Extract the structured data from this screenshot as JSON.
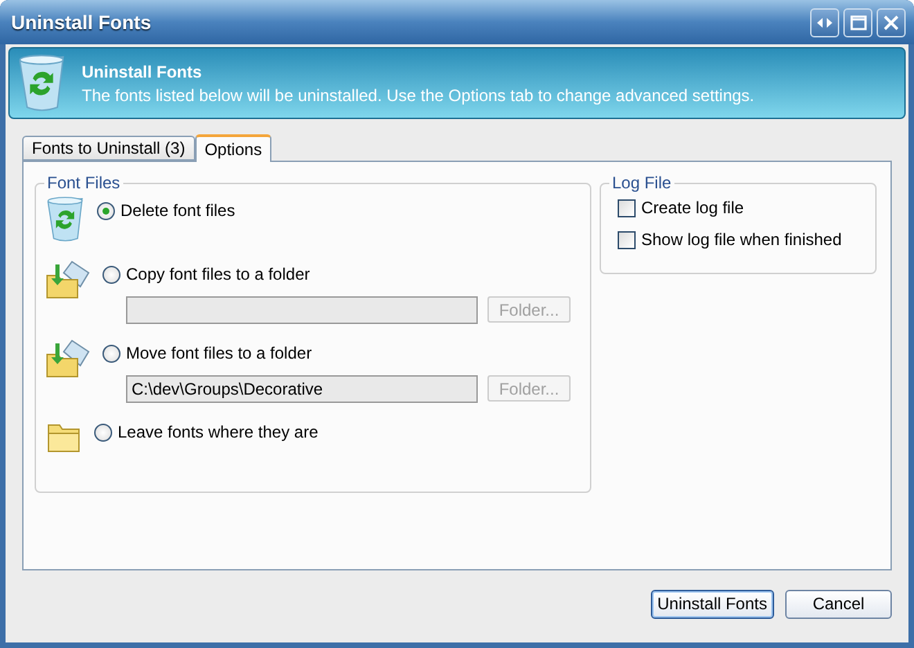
{
  "window": {
    "title": "Uninstall Fonts"
  },
  "header": {
    "title": "Uninstall Fonts",
    "text": "The fonts listed below will be uninstalled. Use the Options tab to change advanced settings."
  },
  "tabs": [
    {
      "label": "Fonts to Uninstall (3)",
      "selected": false
    },
    {
      "label": "Options",
      "selected": true
    }
  ],
  "font_files": {
    "title": "Font Files",
    "options": [
      {
        "label": "Delete font files",
        "selected": true,
        "kind": "bin"
      },
      {
        "label": "Copy font files to a folder",
        "selected": false,
        "kind": "folders",
        "field": {
          "button": {
            "label": "Folder...",
            "disabled": true
          }
        }
      },
      {
        "label": "Move font files to a folder",
        "selected": false,
        "kind": "folders",
        "field": {
          "value": "C:\\dev\\Groups\\Decorative",
          "button": {
            "label": "Folder...",
            "disabled": true
          }
        }
      },
      {
        "label": "Leave fonts where they are",
        "selected": false,
        "kind": "folder"
      }
    ]
  },
  "log_file": {
    "title": "Log File",
    "options": [
      {
        "label": "Create log file",
        "checked": false
      },
      {
        "label": "Show log file when finished",
        "checked": false
      }
    ]
  },
  "buttons": [
    {
      "label": "Uninstall Fonts",
      "default": true
    },
    {
      "label": "Cancel",
      "default": false
    }
  ]
}
